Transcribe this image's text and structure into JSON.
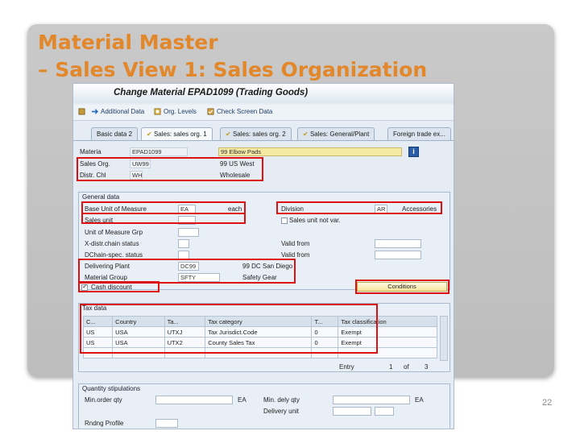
{
  "slide": {
    "title_line1": "Material Master",
    "title_line2": "– Sales View 1: Sales Organization",
    "page_number": "22"
  },
  "window": {
    "title": "Change Material EPAD1099 (Trading Goods)"
  },
  "toolbar": {
    "additional_data": "Additional Data",
    "org_levels": "Org. Levels",
    "check_screen_data": "Check Screen Data"
  },
  "tabs": [
    "Basic data 2",
    "Sales: sales org. 1",
    "Sales: sales org. 2",
    "Sales: General/Plant",
    "Foreign trade ex..."
  ],
  "header": {
    "material_label": "Materia",
    "material_value": "EPAD1099",
    "material_desc": "99 Elbow Pads",
    "sales_org_label": "Sales Org.",
    "sales_org_value": "UW99",
    "sales_org_desc": "99 US West",
    "distr_chl_label": "Distr. Chl",
    "distr_chl_value": "WH",
    "distr_chl_desc": "Wholesale"
  },
  "general": {
    "group_title": "General data",
    "base_uom_label": "Base Unit of Measure",
    "base_uom_value": "EA",
    "base_uom_desc": "each",
    "division_label": "Division",
    "division_value": "AR",
    "division_desc": "Accessories",
    "sales_unit_label": "Sales unit",
    "sales_unit_not_var_label": "Sales unit not var.",
    "uom_grp_label": "Unit of Measure Grp",
    "xdist_status_label": "X-distr.chain status",
    "valid_from_label1": "Valid from",
    "dchain_status_label": "DChain-spec. status",
    "valid_from_label2": "Valid from",
    "delivering_plant_label": "Delivering Plant",
    "delivering_plant_value": "DC99",
    "delivering_plant_desc": "99 DC San Diego",
    "material_group_label": "Material Group",
    "material_group_value": "SFTY",
    "material_group_desc": "Safety Gear",
    "cash_discount_label": "Cash discount",
    "cash_discount_checked": true,
    "conditions_button": "Conditions"
  },
  "tax": {
    "group_title": "Tax data",
    "columns": [
      "C...",
      "Country",
      "Ta...",
      "Tax category",
      "T...",
      "Tax classification"
    ],
    "rows": [
      [
        "US",
        "USA",
        "UTXJ",
        "Tax Jurisdict.Code",
        "0",
        "Exempt"
      ],
      [
        "US",
        "USA",
        "UTX2",
        "County Sales Tax",
        "0",
        "Exempt"
      ]
    ],
    "entry_label": "Entry",
    "entry_current": "1",
    "entry_of": "of",
    "entry_total": "3"
  },
  "quantity": {
    "group_title": "Quantity stipulations",
    "min_order_label": "Min.order qty",
    "min_order_unit": "EA",
    "min_dely_label": "Min. dely qty",
    "min_dely_unit": "EA",
    "delivery_unit_label": "Delivery unit",
    "rounding_label": "Rndng Profile"
  },
  "colors": {
    "title_orange": "#e3872b",
    "highlight_red": "#dd1111",
    "sap_bg": "#e5ecf4"
  }
}
